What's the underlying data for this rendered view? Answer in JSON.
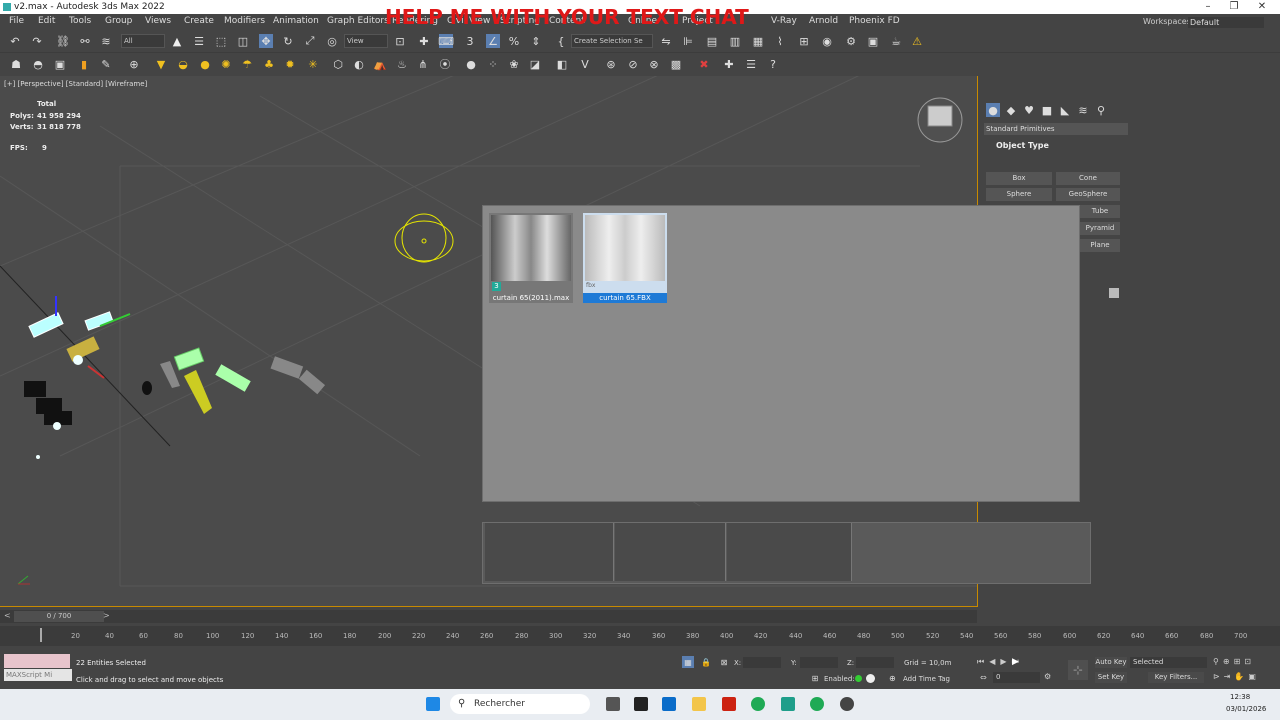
{
  "app": {
    "title": "v2.max - Autodesk 3ds Max 2022",
    "banner": "HELP ME WITH YOUR TEXT CHAT",
    "window_controls": [
      "–",
      "❐",
      "✕"
    ]
  },
  "menu": {
    "items": [
      "File",
      "Edit",
      "Tools",
      "Group",
      "Views",
      "Create",
      "Modifiers",
      "Animation",
      "Graph Editors",
      "Rendering",
      "Civil View",
      "Scripting",
      "Content",
      "Online",
      "Project",
      "V-Ray",
      "Arnold",
      "Phoenix FD"
    ],
    "workspace_label": "Workspaces:",
    "workspace_value": "Default"
  },
  "toolbar": {
    "filter_value": "All",
    "refcoord_value": "View",
    "selection_set_placeholder": "Create Selection Se"
  },
  "viewport": {
    "label": "[+] [Perspective] [Standard] [Wireframe]",
    "stats_header": "Total",
    "polys_label": "Polys:",
    "polys_value": "41 958 294",
    "verts_label": "Verts:",
    "verts_value": "31 818 778",
    "fps_label": "FPS:",
    "fps_value": "9"
  },
  "command_panel": {
    "category": "Standard Primitives",
    "rollout_title": "Object Type",
    "buttons": [
      "Box",
      "Cone",
      "Sphere",
      "GeoSphere",
      "Tube",
      "Pyramid",
      "Plane"
    ]
  },
  "file_dialog": {
    "items": [
      {
        "caption": "curtain 65(2011).max",
        "badge": "3",
        "selected": false
      },
      {
        "caption": "curtain 65.FBX",
        "badge": "fbx",
        "selected": true
      }
    ]
  },
  "timeline": {
    "slider": "0 / 700",
    "ticks": [
      "20",
      "40",
      "60",
      "80",
      "100",
      "120",
      "140",
      "160",
      "180",
      "200",
      "220",
      "240",
      "260",
      "280",
      "300",
      "320",
      "340",
      "360",
      "380",
      "400",
      "420",
      "440",
      "460",
      "480",
      "500",
      "520",
      "540",
      "560",
      "580",
      "600",
      "620",
      "640",
      "660",
      "680",
      "700"
    ]
  },
  "status": {
    "selection": "22 Entities Selected",
    "prompt": "Click and drag to select and move objects",
    "maxscript": "MAXScript Mi",
    "x_label": "X:",
    "y_label": "Y:",
    "z_label": "Z:",
    "grid": "Grid = 10,0m",
    "enabled": "Enabled:",
    "add_time_tag": "Add Time Tag",
    "auto_key": "Auto Key",
    "set_key": "Set Key",
    "key_mode": "Selected",
    "key_filters": "Key Filters...",
    "frame": "0"
  },
  "taskbar": {
    "search_placeholder": "Rechercher",
    "time": "12:38",
    "date": "03/01/2026"
  }
}
